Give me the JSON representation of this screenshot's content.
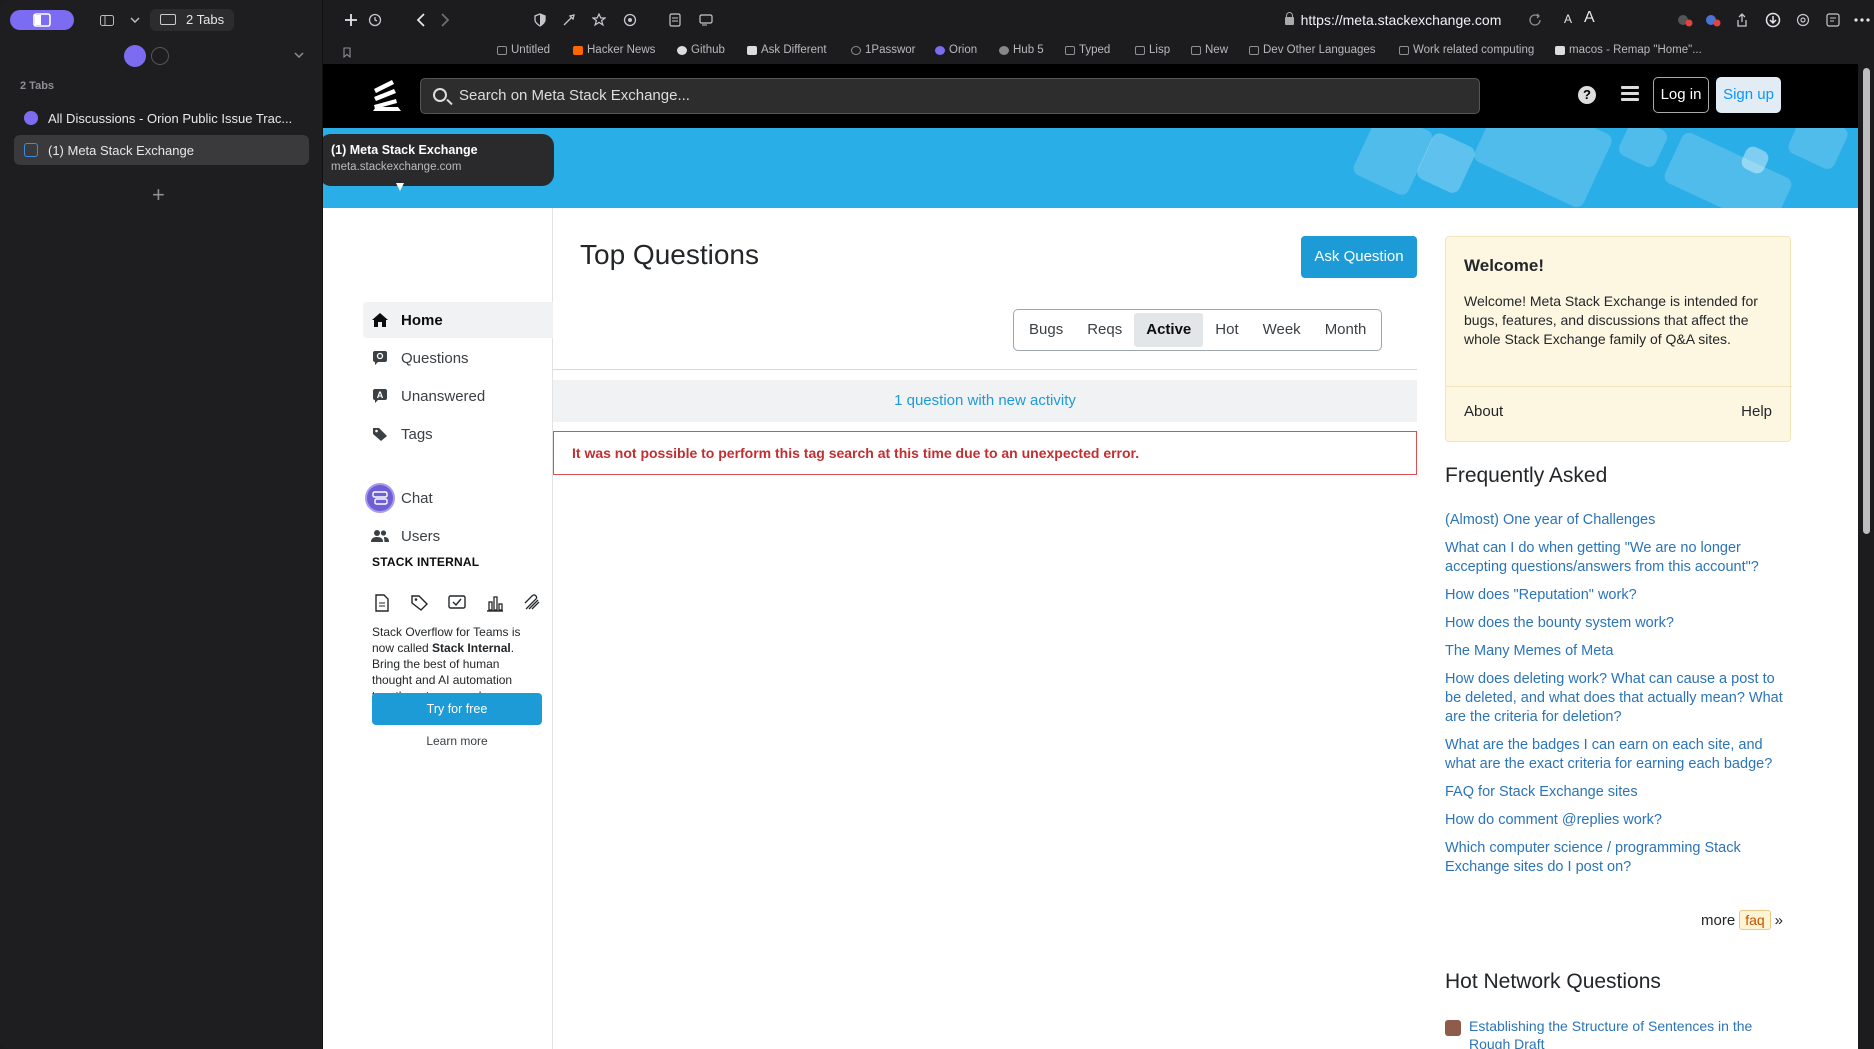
{
  "browser": {
    "sidebar": {
      "tabs_count_label": "2 Tabs",
      "section_label": "2 Tabs",
      "tabs": [
        {
          "title": "All Discussions - Orion Public Issue Trac...",
          "active": false
        },
        {
          "title": "(1) Meta Stack Exchange",
          "active": true
        }
      ],
      "accent_color": "#7c6cf2"
    },
    "toolbar": {
      "url": "https://meta.stackexchange.com",
      "text_size_small": "A",
      "text_size_large": "A"
    },
    "bookmarks": [
      {
        "label": "Untitled",
        "icon": "folder-icon"
      },
      {
        "label": "Hacker News",
        "icon": "hackernews-icon"
      },
      {
        "label": "Github",
        "icon": "github-icon"
      },
      {
        "label": "Ask Different",
        "icon": "askdifferent-icon"
      },
      {
        "label": "1Passwor",
        "icon": "onepassword-icon"
      },
      {
        "label": "Orion",
        "icon": "orion-icon"
      },
      {
        "label": "Hub 5",
        "icon": "hub-icon"
      },
      {
        "label": "Typed",
        "icon": "folder-icon"
      },
      {
        "label": "Lisp",
        "icon": "folder-icon"
      },
      {
        "label": "New",
        "icon": "folder-icon"
      },
      {
        "label": "Dev Other Languages",
        "icon": "folder-icon"
      },
      {
        "label": "Work related computing",
        "icon": "folder-icon"
      },
      {
        "label": "macos - Remap \"Home\"...",
        "icon": "stackexchange-icon"
      }
    ],
    "hover_card": {
      "title": "(1) Meta Stack Exchange",
      "domain": "meta.stackexchange.com"
    }
  },
  "site": {
    "header": {
      "search_placeholder": "Search on Meta Stack Exchange...",
      "help_icon": "?",
      "login_label": "Log in",
      "signup_label": "Sign up"
    },
    "left_nav": {
      "items": [
        {
          "label": "Home",
          "icon": "home-icon",
          "active": true
        },
        {
          "label": "Questions",
          "icon": "questions-icon"
        },
        {
          "label": "Unanswered",
          "icon": "unanswered-icon"
        },
        {
          "label": "Tags",
          "icon": "tag-icon"
        },
        {
          "label": "Chat",
          "icon": "chat-icon"
        },
        {
          "label": "Users",
          "icon": "users-icon"
        }
      ],
      "stack_internal": {
        "heading": "STACK INTERNAL",
        "text_before": "Stack Overflow for Teams is now called ",
        "text_bold": "Stack Internal",
        "text_after": ". Bring the best of human thought and AI automation together at your work.",
        "cta": "Try for free",
        "learn_more": "Learn more"
      }
    },
    "main": {
      "title": "Top Questions",
      "ask_button": "Ask Question",
      "filters": [
        {
          "label": "Bugs"
        },
        {
          "label": "Reqs"
        },
        {
          "label": "Active",
          "active": true
        },
        {
          "label": "Hot"
        },
        {
          "label": "Week"
        },
        {
          "label": "Month"
        }
      ],
      "new_activity": "1 question with new activity",
      "error": "It was not possible to perform this tag search at this time due to an unexpected error."
    },
    "right_sidebar": {
      "welcome": {
        "title": "Welcome!",
        "text": "Welcome! Meta Stack Exchange is intended for bugs, features, and discussions that affect the whole Stack Exchange family of Q&A sites.",
        "about": "About",
        "help": "Help"
      },
      "faq_heading": "Frequently Asked",
      "faq": [
        "(Almost) One year of Challenges",
        "What can I do when getting \"We are no longer accepting questions/answers from this account\"?",
        "How does \"Reputation\" work?",
        "How does the bounty system work?",
        "The Many Memes of Meta",
        "How does deleting work? What can cause a post to be deleted, and what does that actually mean? What are the criteria for deletion?",
        "What are the badges I can earn on each site, and what are the exact criteria for earning each badge?",
        "FAQ for Stack Exchange sites",
        "How do comment @replies work?",
        "Which computer science / programming Stack Exchange sites do I post on?"
      ],
      "more_label": "more",
      "more_tag": "faq",
      "more_arrow": "»",
      "hnq_heading": "Hot Network Questions",
      "hnq": [
        "Establishing the Structure of Sentences in the Rough Draft"
      ]
    },
    "colors": {
      "accent_blue": "#1d9bd6",
      "link_blue": "#2b74b8",
      "error_red": "#c22e32",
      "banner_blue": "#2aaee8"
    }
  }
}
